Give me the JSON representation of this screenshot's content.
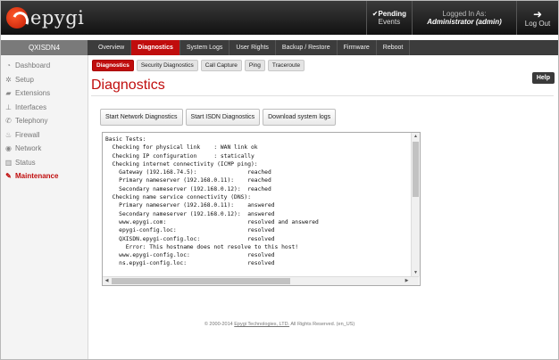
{
  "app": {
    "logo_text": "epygi"
  },
  "header": {
    "pending_line1": "Pending",
    "pending_line2": "Events",
    "logged_label": "Logged In As:",
    "logged_user": "Administrator (admin)",
    "logout_label": "Log Out"
  },
  "sidebar": {
    "title": "QXISDN4",
    "items": [
      {
        "label": "Dashboard",
        "icon": "dashboard-icon"
      },
      {
        "label": "Setup",
        "icon": "gear-icon"
      },
      {
        "label": "Extensions",
        "icon": "extensions-icon"
      },
      {
        "label": "Interfaces",
        "icon": "interfaces-icon"
      },
      {
        "label": "Telephony",
        "icon": "phone-icon"
      },
      {
        "label": "Firewall",
        "icon": "fire-icon"
      },
      {
        "label": "Network",
        "icon": "globe-icon"
      },
      {
        "label": "Status",
        "icon": "status-icon"
      },
      {
        "label": "Maintenance",
        "icon": "wrench-icon"
      }
    ]
  },
  "tabs": [
    "Overview",
    "Diagnostics",
    "System Logs",
    "User Rights",
    "Backup / Restore",
    "Firmware",
    "Reboot"
  ],
  "subtabs": [
    "Diagnostics",
    "Security Diagnostics",
    "Call Capture",
    "Ping",
    "Traceroute"
  ],
  "page": {
    "help_label": "Help",
    "title": "Diagnostics",
    "buttons": [
      "Start Network Diagnostics",
      "Start ISDN Diagnostics",
      "Download system logs"
    ]
  },
  "console_lines": [
    "Basic Tests:",
    "  Checking for physical link    : WAN link ok",
    "  Checking IP configuration     : statically",
    "  Checking internet connectivity (ICMP ping):",
    "    Gateway (192.168.74.5):               reached",
    "    Primary nameserver (192.168.0.11):    reached",
    "    Secondary nameserver (192.168.0.12):  reached",
    "  Checking name service connectivity (DNS):",
    "    Primary nameserver (192.168.0.11):    answered",
    "    Secondary nameserver (192.168.0.12):  answered",
    "    www.epygi.com:                        resolved and answered",
    "    epygi-config.loc:                     resolved",
    "    QXISDN.epygi-config.loc:              resolved",
    "      Error: This hostname does not resolve to this host!",
    "    www.epygi-config.loc:                 resolved",
    "    ns.epygi-config.loc:                  resolved"
  ],
  "footer": {
    "prefix": "© 2000-2014 ",
    "link": "Epygi Technologies, LTD.",
    "suffix": " All Rights Reserved. (en_US)"
  },
  "colors": {
    "accent": "#c00d0d",
    "nav_bg": "#3c3c3c",
    "header_bg": "#1a1a1a"
  }
}
